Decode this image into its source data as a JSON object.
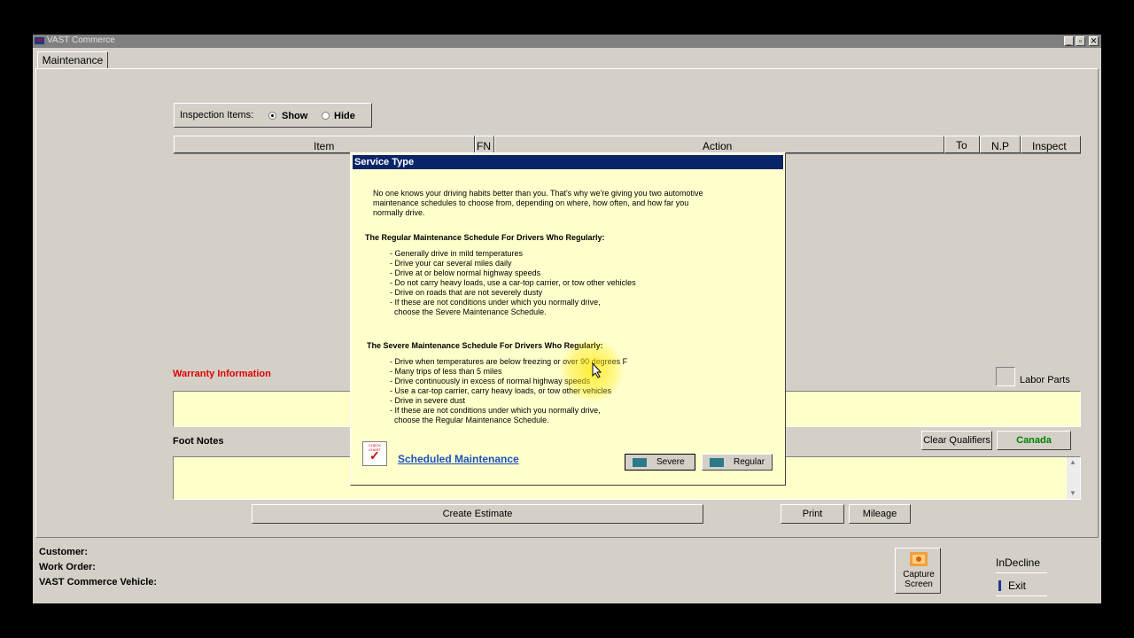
{
  "window": {
    "title": "VAST Commerce",
    "minimize": "_",
    "restore": "▫",
    "close": "✕"
  },
  "tabs": {
    "maintenance": "Maintenance"
  },
  "inspection": {
    "label": "Inspection Items:",
    "show": "Show",
    "hide": "Hide",
    "selected": "Show"
  },
  "table": {
    "columns": [
      "Item",
      "FN",
      "Action",
      "To",
      "N.P",
      "Inspect"
    ]
  },
  "warranty": {
    "label": "Warranty Information"
  },
  "labor_parts": {
    "label": "Labor Parts"
  },
  "footnotes": {
    "label": "Foot Notes"
  },
  "buttons": {
    "clear_qualifiers": "Clear Qualifiers",
    "canada": "Canada",
    "create_estimate": "Create Estimate",
    "print": "Print",
    "mileage": "Mileage",
    "capture_screen_1": "Capture",
    "capture_screen_2": "Screen",
    "indecline": "InDecline",
    "exit": "Exit"
  },
  "footer": {
    "customer": "Customer:",
    "work_order": "Work Order:",
    "vehicle": "VAST Commerce Vehicle:"
  },
  "dialog": {
    "title": "Service Type",
    "intro_1": "No one knows your driving habits better than you.  That's why we're giving you two automotive",
    "intro_2": "maintenance schedules to choose from, depending on where, how often, and how far you",
    "intro_3": "normally drive.",
    "regular_heading": "The Regular Maintenance Schedule For Drivers Who Regularly:",
    "regular_items": [
      "- Generally drive in mild temperatures",
      "- Drive your car several miles daily",
      "- Drive at or below normal highway speeds",
      "- Do not carry heavy loads, use a car-top carrier, or tow other vehicles",
      "- Drive on roads that are not severely dusty",
      "- If these are not conditions under which you normally drive,",
      "  choose the Severe Maintenance Schedule."
    ],
    "severe_heading": "The Severe Maintenance Schedule For Drivers Who Regularly:",
    "severe_items": [
      "- Drive when temperatures are below freezing or over 90 degrees F",
      "- Many trips of less than 5 miles",
      "- Drive continuously in excess of normal highway speeds",
      "- Use a car-top carrier, carry heavy loads, or tow other vehicles",
      "- Drive in severe dust",
      "- If these are not conditions under which you normally drive,",
      "  choose the Regular Maintenance Schedule."
    ],
    "link": "Scheduled Maintenance",
    "logo_text": "CHECK CHART",
    "severe_button": "Severe",
    "regular_button": "Regular"
  },
  "colors": {
    "accent_red": "#e00000",
    "canada_green": "#008000",
    "title_blue": "#0a246a",
    "yellow_field": "#ffffc8"
  }
}
